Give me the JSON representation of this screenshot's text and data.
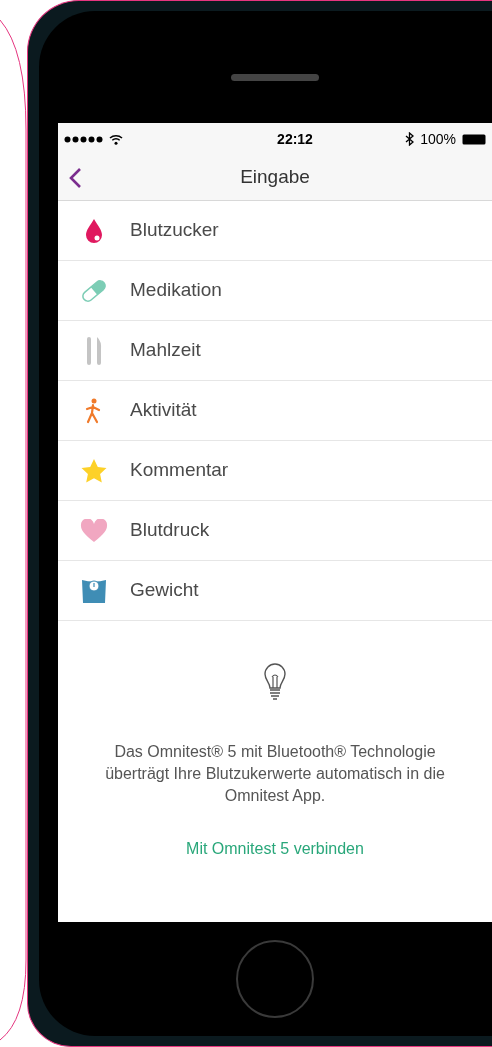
{
  "status_bar": {
    "time": "22:12",
    "battery": "100%"
  },
  "nav": {
    "title": "Eingabe"
  },
  "items": [
    {
      "label": "Blutzucker",
      "kind": "drop"
    },
    {
      "label": "Medikation",
      "kind": "pill"
    },
    {
      "label": "Mahlzeit",
      "kind": "cutlery"
    },
    {
      "label": "Aktivität",
      "kind": "walker"
    },
    {
      "label": "Kommentar",
      "kind": "star"
    },
    {
      "label": "Blutdruck",
      "kind": "heart"
    },
    {
      "label": "Gewicht",
      "kind": "scale"
    }
  ],
  "info": {
    "text": "Das Omnitest® 5 mit Bluetooth® Technologie überträgt Ihre Blutzukerwerte automatisch in die Omnitest App.",
    "link": "Mit Omnitest 5 verbinden"
  }
}
